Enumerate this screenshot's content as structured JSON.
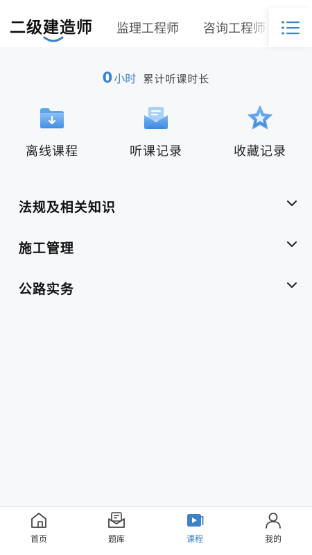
{
  "header": {
    "tabs": [
      {
        "label": "二级建造师",
        "active": true
      },
      {
        "label": "监理工程师",
        "active": false
      },
      {
        "label": "咨询工程师",
        "active": false
      }
    ],
    "menu_icon": "list-menu-icon"
  },
  "summary": {
    "hours": "0",
    "unit": "小时",
    "label": "累计听课时长"
  },
  "quick_actions": [
    {
      "label": "离线课程",
      "icon": "folder-download-icon"
    },
    {
      "label": "听课记录",
      "icon": "mail-record-icon"
    },
    {
      "label": "收藏记录",
      "icon": "star-icon"
    }
  ],
  "sections": [
    {
      "title": "法规及相关知识"
    },
    {
      "title": "施工管理"
    },
    {
      "title": "公路实务"
    }
  ],
  "bottom_nav": [
    {
      "label": "首页",
      "icon": "home-icon",
      "active": false
    },
    {
      "label": "题库",
      "icon": "question-bank-icon",
      "active": false
    },
    {
      "label": "课程",
      "icon": "course-play-icon",
      "active": true
    },
    {
      "label": "我的",
      "icon": "profile-icon",
      "active": false
    }
  ],
  "colors": {
    "accent": "#3b82c9",
    "background": "#f7f8fa"
  }
}
